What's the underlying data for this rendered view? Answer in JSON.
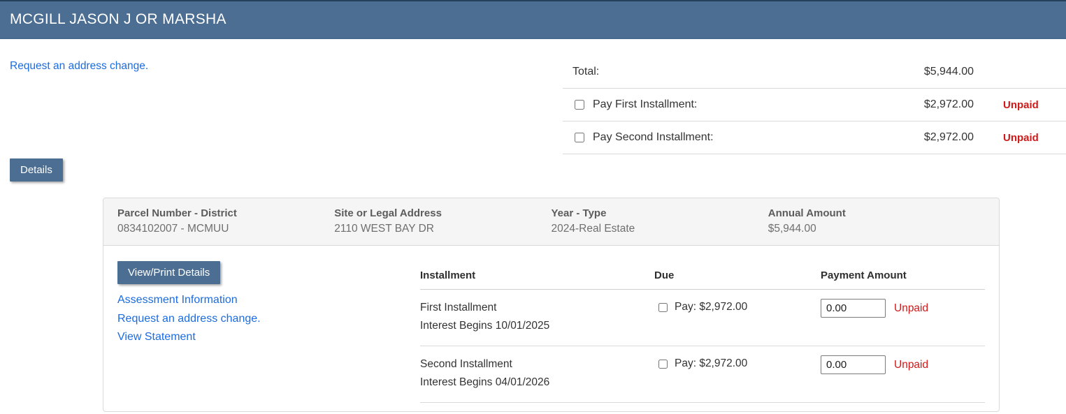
{
  "colors": {
    "accent": "#4b6e92",
    "accent_dark": "#24415c",
    "link": "#1b6ce0",
    "unpaid_red": "#d01919",
    "panel_header_bg": "#f5f5f5",
    "divider": "#d9d9d9"
  },
  "title_bar": {
    "text": "MCGILL JASON J OR MARSHA"
  },
  "top": {
    "address_link": "Request an address change."
  },
  "summary": {
    "total": {
      "label": "Total:",
      "amount": "$5,944.00"
    },
    "installments": [
      {
        "label": "Pay First Installment:",
        "amount": "$2,972.00",
        "status": "Unpaid"
      },
      {
        "label": "Pay Second Installment:",
        "amount": "$2,972.00",
        "status": "Unpaid"
      }
    ]
  },
  "details_button_label": "Details",
  "panel": {
    "summary_columns": [
      {
        "label": "Parcel Number - District",
        "value": "0834102007 - MCMUU"
      },
      {
        "label": "Site or Legal Address",
        "value": "2110 WEST BAY DR"
      },
      {
        "label": "Year - Type",
        "value": "2024-Real Estate"
      },
      {
        "label": "Annual Amount",
        "value": "$5,944.00"
      }
    ],
    "actions": {
      "view_print_label": "View/Print Details",
      "links": [
        "Assessment Information",
        "Request an address change.",
        "View Statement"
      ]
    },
    "table": {
      "headers": {
        "installment": "Installment",
        "due": "Due",
        "payment": "Payment Amount"
      },
      "rows": [
        {
          "name": "First Installment",
          "interest_note": "Interest Begins 10/01/2025",
          "due_label": "Pay: $2,972.00",
          "payment_value": "0.00",
          "status": "Unpaid"
        },
        {
          "name": "Second Installment",
          "interest_note": "Interest Begins 04/01/2026",
          "due_label": "Pay: $2,972.00",
          "payment_value": "0.00",
          "status": "Unpaid"
        }
      ]
    }
  }
}
